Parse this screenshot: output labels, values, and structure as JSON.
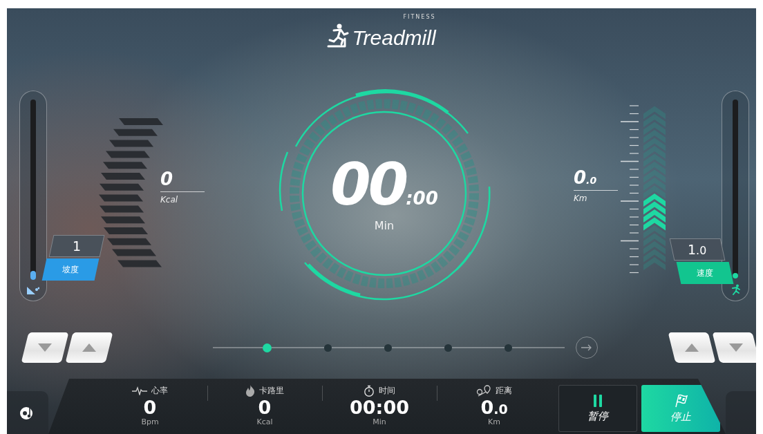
{
  "logo": {
    "brand": "Treadmill",
    "tagline": "FITNESS"
  },
  "incline": {
    "value": "1",
    "label": "坡度",
    "level": 0.05
  },
  "calories": {
    "value": "0",
    "unit": "Kcal"
  },
  "timer": {
    "minutes": "00",
    "seconds": ":00",
    "unit": "Min"
  },
  "distance": {
    "value": "0",
    "fraction": ".0",
    "unit": "Km"
  },
  "speed": {
    "value": "1",
    "fraction": ".0",
    "label": "速度",
    "level": 0.03
  },
  "pager": {
    "dots": [
      {
        "selected": true
      },
      {
        "selected": false
      },
      {
        "selected": false
      },
      {
        "selected": false
      },
      {
        "selected": false
      }
    ]
  },
  "stats": [
    {
      "kind": "heart",
      "label": "心率",
      "value": "0",
      "unit": "Bpm"
    },
    {
      "kind": "flame",
      "label": "卡路里",
      "value": "0",
      "unit": "Kcal"
    },
    {
      "kind": "timer",
      "label": "时间",
      "value": "00:00",
      "unit": "Min"
    },
    {
      "kind": "distance",
      "label": "距离",
      "value": "0",
      "fraction": ".0",
      "unit": "Km"
    }
  ],
  "buttons": [
    {
      "kind": "pause",
      "label": "暂停"
    },
    {
      "kind": "stop",
      "label": "停止"
    }
  ]
}
